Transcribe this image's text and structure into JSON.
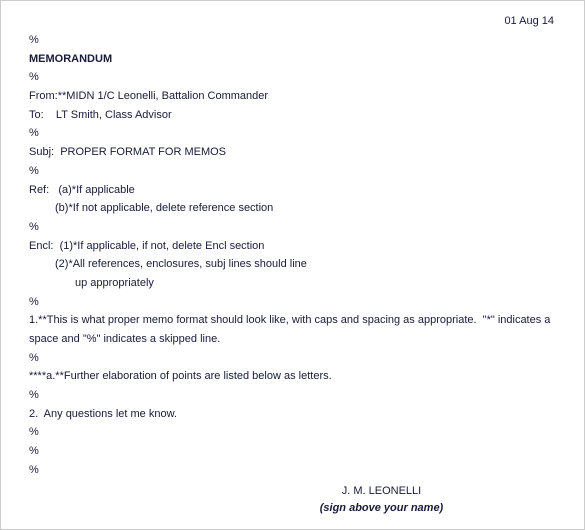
{
  "date": "01 Aug 14",
  "spacer": "%",
  "title": "MEMORANDUM",
  "from_label": "From:",
  "from_value": "**MIDN 1/C Leonelli, Battalion Commander",
  "to_label": "To:    ",
  "to_value": "LT Smith, Class Advisor",
  "subj_label": "Subj:  ",
  "subj_value": "PROPER FORMAT FOR MEMOS",
  "ref_label": "Ref:   ",
  "ref_a": "(a)*If applicable",
  "ref_b": "(b)*If not applicable, delete reference section",
  "encl_label": "Encl:  ",
  "encl_1": "(1)*If applicable, if not, delete Encl section",
  "encl_2": "(2)*All references, enclosures, subj lines should line",
  "encl_2b": "up appropriately",
  "body_1": "1.**This is what proper memo format should look like, with caps and spacing as appropriate.  \"*\" indicates a space and \"%\" indicates a skipped line.",
  "body_1a": "****a.**Further elaboration of points are listed below as letters.",
  "body_2": "2.  Any questions let me know.",
  "sig_name": "J. M. LEONELLI",
  "sig_instr": "(sign above your name)"
}
